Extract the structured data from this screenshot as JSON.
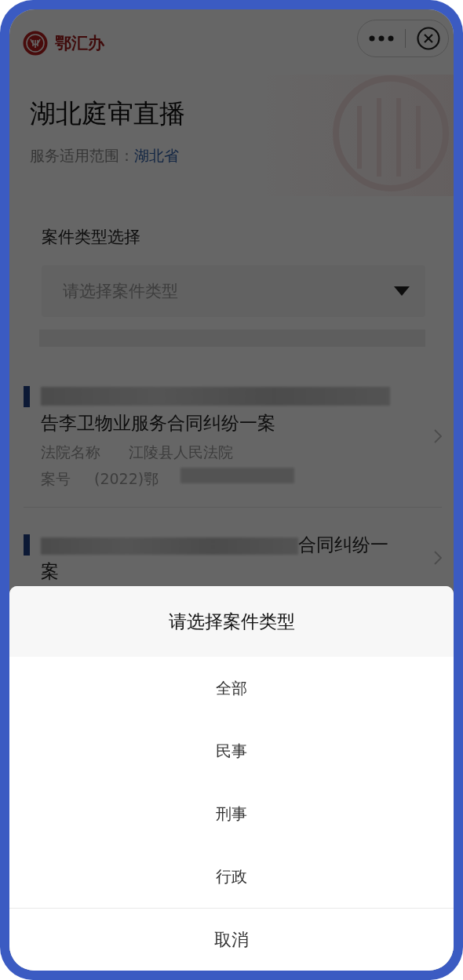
{
  "app_bar": {
    "brand": "鄂汇办"
  },
  "header": {
    "title": "湖北庭审直播",
    "scope_label": "服务适用范围：",
    "scope_value": "湖北省"
  },
  "filter": {
    "label": "案件类型选择",
    "placeholder": "请选择案件类型"
  },
  "cases": [
    {
      "kind": "redacted-line",
      "title": "告李卫物业服务合同纠纷一案",
      "court_label": "法院名称",
      "court": "江陵县人民法院",
      "number_label": "案号",
      "number": "(2022)鄂"
    },
    {
      "kind": "redacted-inline",
      "title": "合同纠纷一案"
    }
  ],
  "sheet": {
    "title": "请选择案件类型",
    "options": [
      "全部",
      "民事",
      "刑事",
      "行政"
    ],
    "cancel": "取消"
  }
}
